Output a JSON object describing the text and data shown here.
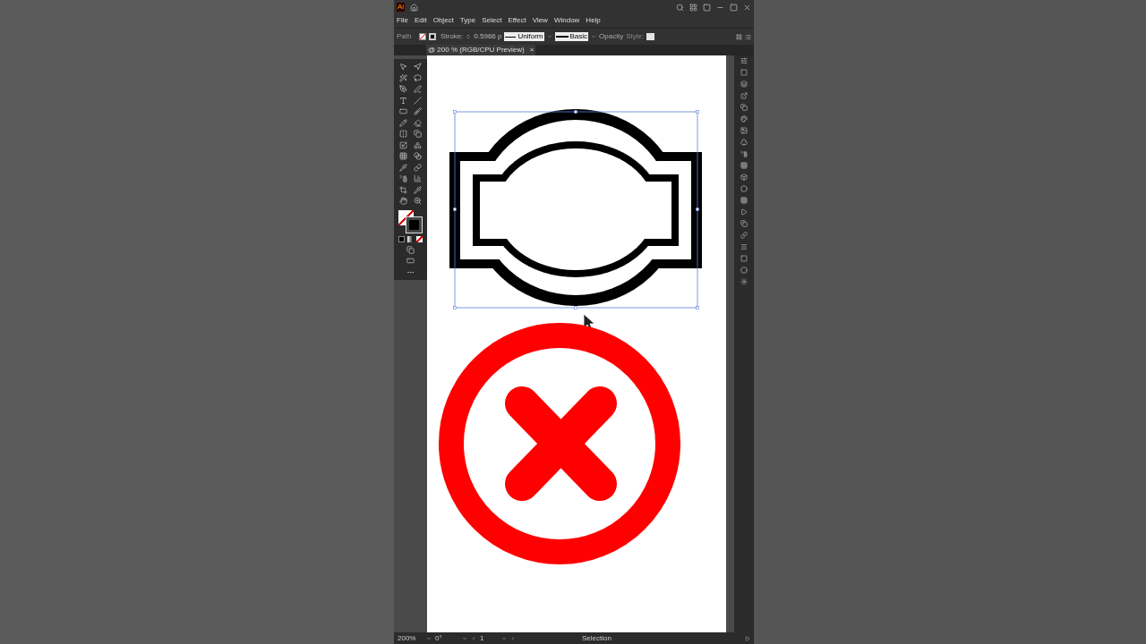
{
  "window": {
    "app_badge": "Ai",
    "menu": [
      "File",
      "Edit",
      "Object",
      "Type",
      "Select",
      "Effect",
      "View",
      "Window",
      "Help"
    ]
  },
  "control_bar": {
    "selection_label": "Path",
    "stroke_label": "Stroke:",
    "stroke_weight": "0.5966 p",
    "profile": "Uniform",
    "brush": "Basic",
    "opacity_label": "Opacity",
    "style_label": "Style:"
  },
  "document_tab": {
    "title": "@ 200 % (RGB/CPU Preview)",
    "close": "×"
  },
  "status_bar": {
    "zoom": "200%",
    "rotation": "0°",
    "artboard": "1",
    "tool": "Selection"
  }
}
